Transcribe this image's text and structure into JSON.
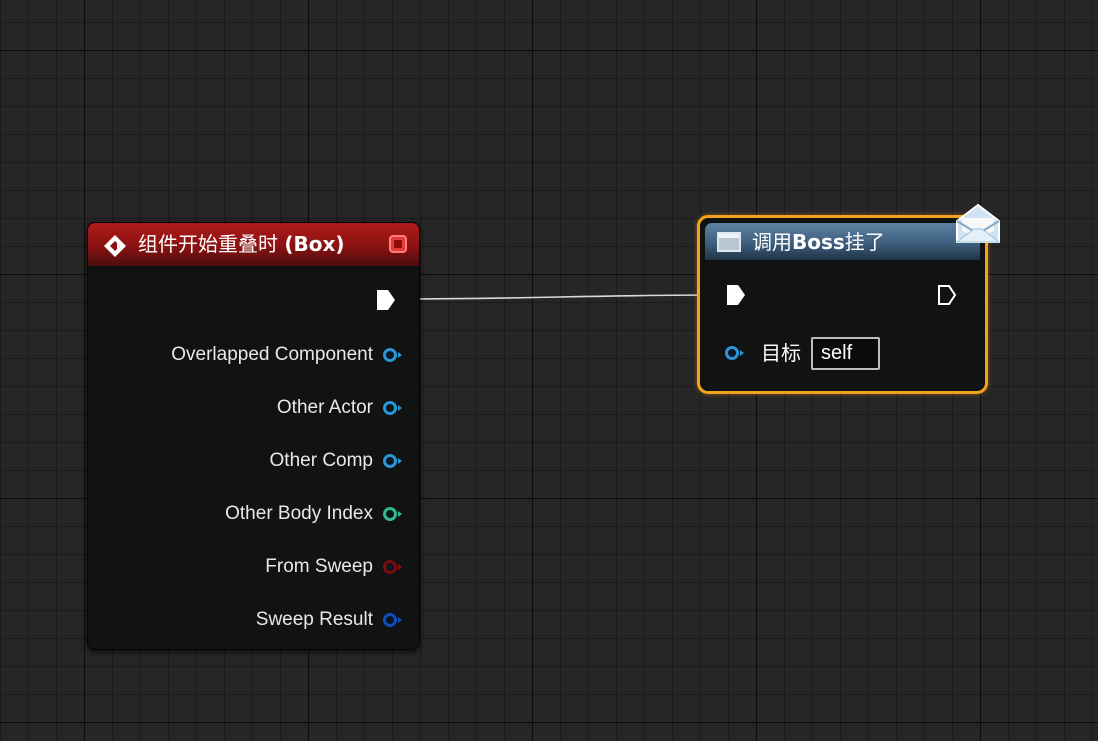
{
  "event_node": {
    "title": "组件开始重叠时",
    "title_suffix": "(Box)",
    "pins": [
      {
        "label": "Overlapped Component",
        "type": "object"
      },
      {
        "label": "Other Actor",
        "type": "object"
      },
      {
        "label": "Other Comp",
        "type": "object"
      },
      {
        "label": "Other Body Index",
        "type": "integer"
      },
      {
        "label": "From Sweep",
        "type": "boolean"
      },
      {
        "label": "Sweep Result",
        "type": "struct"
      }
    ]
  },
  "function_node": {
    "title_prefix": "调用",
    "title_bold": "Boss",
    "title_suffix": "挂了",
    "target_label": "目标",
    "target_value": "self"
  },
  "colors": {
    "event_header": "#8a1212",
    "function_header": "#3e5f7e",
    "selection_border": "#f2a21c",
    "object_pin": "#2a94d6",
    "integer_pin": "#2fb98f",
    "boolean_pin": "#7a0c0c",
    "struct_pin": "#0d4fb8",
    "background": "#262626"
  },
  "icons": {
    "event": "event-diamond-icon",
    "delegate": "delegate-icon",
    "function": "function-icon",
    "message": "message-envelope-icon"
  }
}
